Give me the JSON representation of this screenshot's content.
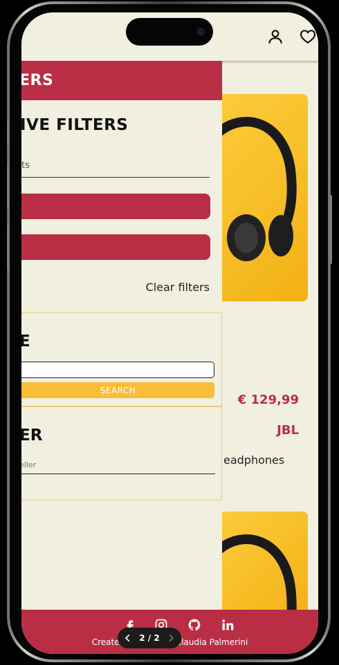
{
  "header": {
    "account_icon": "user-icon",
    "wishlist_icon": "heart-icon"
  },
  "drawer": {
    "title": "ERS",
    "active_filters_title": "IVE FILTERS",
    "active_filters_value": "ts",
    "clear_filters_label": "Clear filters",
    "name_section_title": "E",
    "search_button_label": "SEARCH",
    "seller_section_title": "ER",
    "seller_placeholder": "eller"
  },
  "product": {
    "price": "€ 129,99",
    "brand": "JBL",
    "name": "eadphones"
  },
  "footer": {
    "social": [
      "facebook-icon",
      "instagram-icon",
      "github-icon",
      "linkedin-icon"
    ],
    "credit_prefix": "Created",
    "credit_author": "Claudia Palmerini"
  },
  "pager": {
    "label": "2 / 2"
  },
  "colors": {
    "primary": "#ba2e45",
    "accent": "#f9be38",
    "background": "#f0efe0"
  }
}
